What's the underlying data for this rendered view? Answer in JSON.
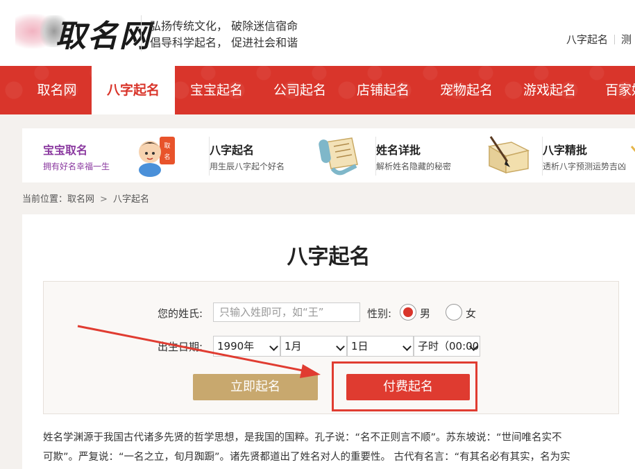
{
  "header": {
    "logo_text": "取名网",
    "slogan_line1": "弘扬传统文化， 破除迷信宿命",
    "slogan_line2": "倡导科学起名， 促进社会和谐",
    "top_links": [
      "八字起名",
      "测"
    ]
  },
  "nav": {
    "items": [
      "取名网",
      "八字起名",
      "宝宝起名",
      "公司起名",
      "店铺起名",
      "宠物起名",
      "游戏起名",
      "百家姓"
    ],
    "active_index": 1
  },
  "features": [
    {
      "title": "宝宝取名",
      "subtitle": "拥有好名幸福一生",
      "icon": "baby-icon"
    },
    {
      "title": "八字起名",
      "subtitle": "用生辰八字起个好名",
      "icon": "scroll-icon"
    },
    {
      "title": "姓名详批",
      "subtitle": "解析姓名隐藏的秘密",
      "icon": "book-brush-icon"
    },
    {
      "title": "八字精批",
      "subtitle": "透析八字预测运势吉凶",
      "icon": "brush-icon"
    }
  ],
  "breadcrumb": {
    "prefix": "当前位置：",
    "home": "取名网",
    "separator": ">",
    "current": "八字起名"
  },
  "main": {
    "title": "八字起名",
    "form": {
      "surname_label": "您的姓氏:",
      "surname_placeholder": "只输入姓即可，如“王”",
      "surname_value": "",
      "gender_label": "性别:",
      "gender_male": "男",
      "gender_female": "女",
      "gender_selected": "男",
      "birth_label": "出生日期:",
      "year": "1990年",
      "month": "1月",
      "day": "1日",
      "hour": "子时（00:00",
      "free_button": "立即起名",
      "paid_button": "付费起名"
    },
    "paragraph_line1": "姓名学渊源于我国古代诸多先贤的哲学思想，是我国的国粹。孔子说：“名不正则言不顺”。苏东坡说：“世间唯名实不",
    "paragraph_line2": "可欺”。严复说：“一名之立，旬月踟蹰”。诸先贤都道出了姓名对人的重要性。 古代有名言：“有其名必有其实，名为实"
  },
  "colors": {
    "brand_red": "#d9352b",
    "gold_button": "#c8a86e",
    "paid_button": "#df3b30",
    "annotation_red": "#e03c31",
    "feature_purple": "#8b3aa0"
  }
}
